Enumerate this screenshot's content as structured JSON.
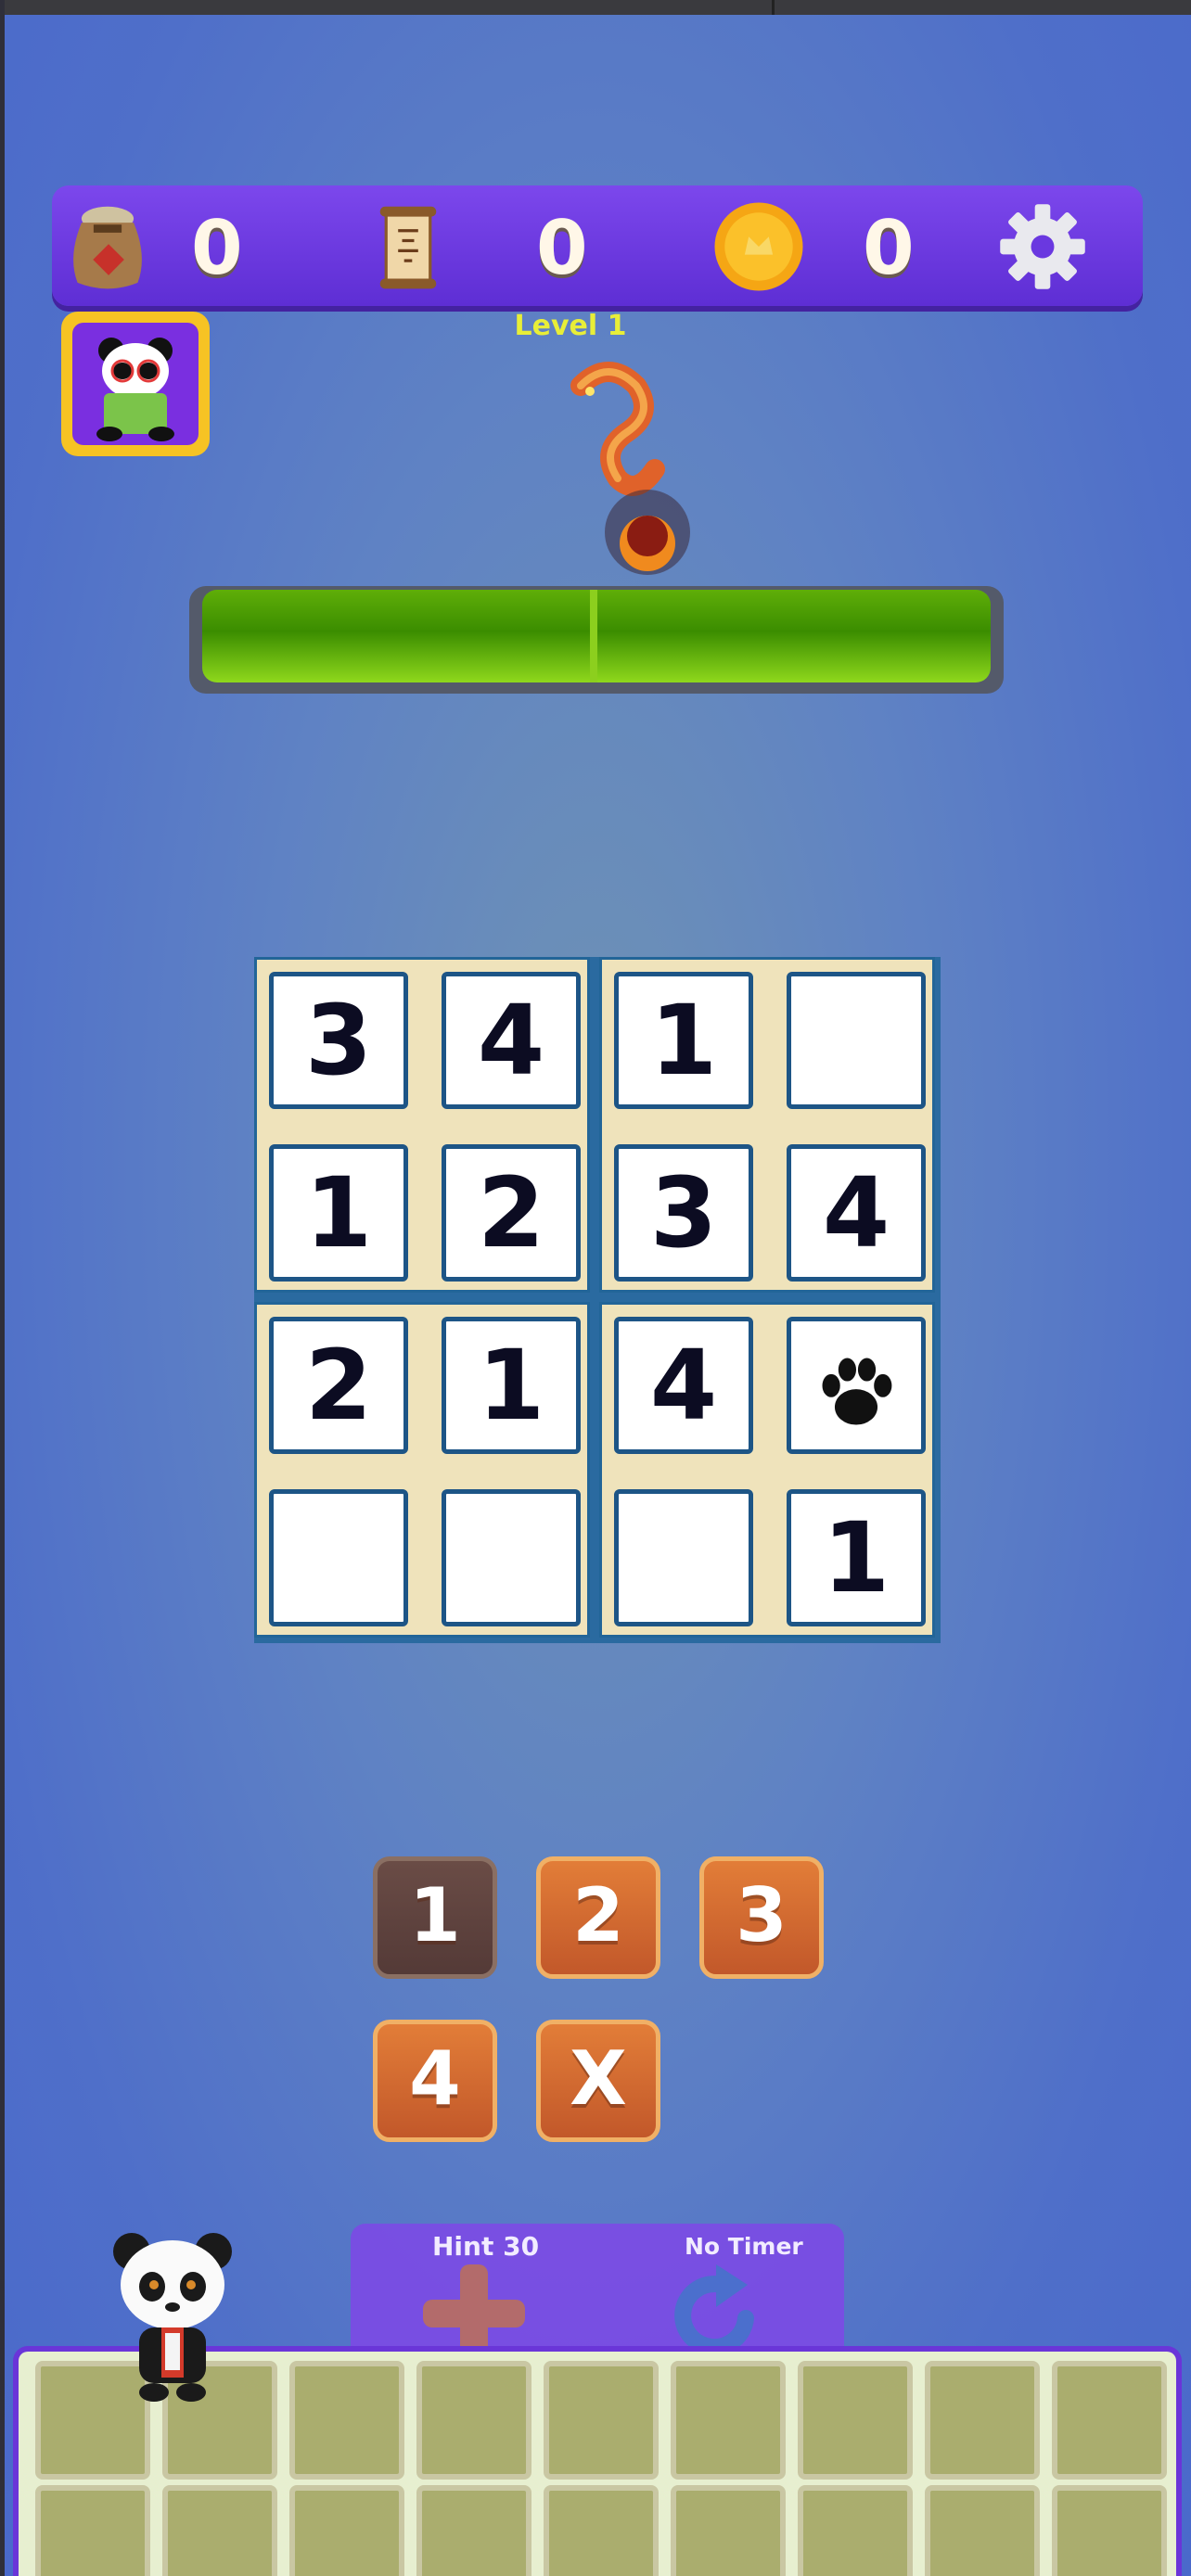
{
  "resources": {
    "rice_count": "0",
    "scroll_count": "0",
    "coin_count": "0"
  },
  "level": {
    "label": "Level 1"
  },
  "progress": {
    "fill_fraction": 1.0
  },
  "board": {
    "rows": [
      [
        "3",
        "4",
        "1",
        ""
      ],
      [
        "1",
        "2",
        "3",
        "4"
      ],
      [
        "2",
        "1",
        "4",
        "paw"
      ],
      [
        "",
        "",
        "",
        "1"
      ]
    ]
  },
  "pad": {
    "buttons": [
      "1",
      "2",
      "3",
      "4",
      "X"
    ],
    "disabled_index": 0
  },
  "hint": {
    "label": "Hint 30"
  },
  "timer": {
    "label": "No Timer"
  },
  "colors": {
    "bar_purple": "#6a38e0",
    "board_blue": "#226598",
    "pad_orange": "#d66a30",
    "level_yellow": "#e8ee38"
  },
  "icons": [
    "rice-bag-icon",
    "scroll-icon",
    "coin-icon",
    "gear-icon",
    "panda-avatar-icon",
    "dragon-icon",
    "paw-icon",
    "plus-icon",
    "refresh-icon"
  ]
}
